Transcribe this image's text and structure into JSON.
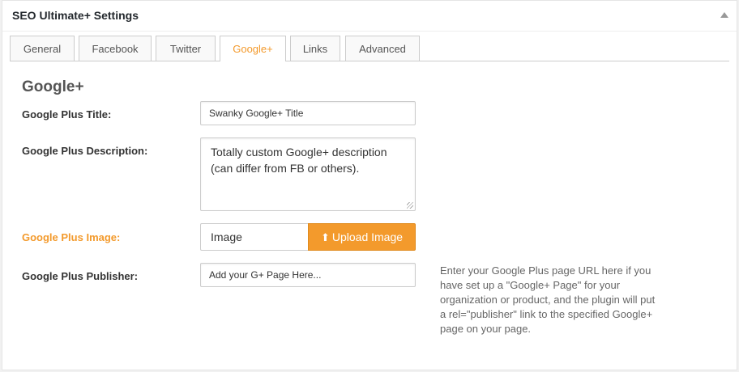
{
  "panel": {
    "title": "SEO Ultimate+ Settings"
  },
  "tabs": [
    {
      "label": "General",
      "active": false
    },
    {
      "label": "Facebook",
      "active": false
    },
    {
      "label": "Twitter",
      "active": false
    },
    {
      "label": "Google+",
      "active": true
    },
    {
      "label": "Links",
      "active": false
    },
    {
      "label": "Advanced",
      "active": false
    }
  ],
  "section": {
    "heading": "Google+"
  },
  "fields": {
    "title": {
      "label": "Google Plus Title:",
      "value": "Swanky Google+ Title"
    },
    "description": {
      "label": "Google Plus Description:",
      "value": "Totally custom Google+ description (can differ from FB or others)."
    },
    "image": {
      "label": "Google Plus Image:",
      "value": "Image",
      "button_label": "Upload Image",
      "button_icon": "upload-icon"
    },
    "publisher": {
      "label": "Google Plus Publisher:",
      "placeholder": "Add your G+ Page Here...",
      "help": "Enter your Google Plus page URL here if you have set up a \"Google+ Page\" for your organization or product, and the plugin will put a rel=\"publisher\" link to the specified Google+ page on your page."
    }
  },
  "colors": {
    "accent": "#f39a2c",
    "border": "#cccccc",
    "text": "#333333"
  }
}
